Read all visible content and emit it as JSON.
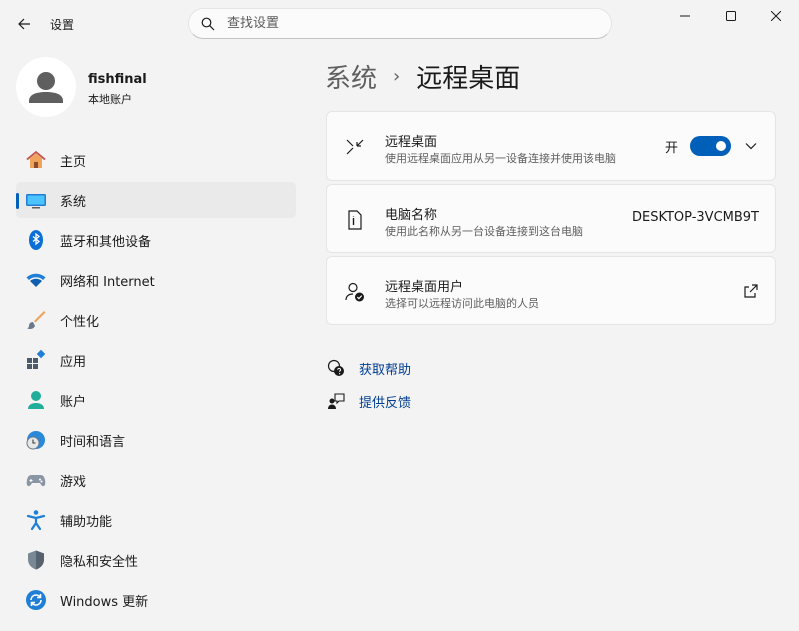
{
  "window": {
    "title": "设置",
    "controls": {
      "minimize": "minimize-icon",
      "maximize": "maximize-icon",
      "close": "close-icon"
    }
  },
  "search": {
    "placeholder": "查找设置",
    "value": ""
  },
  "profile": {
    "name": "fishfinal",
    "account_type": "本地账户"
  },
  "nav": {
    "items": [
      {
        "label": "主页",
        "icon": "home-icon",
        "active": false
      },
      {
        "label": "系统",
        "icon": "system-icon",
        "active": true
      },
      {
        "label": "蓝牙和其他设备",
        "icon": "bluetooth-icon",
        "active": false
      },
      {
        "label": "网络和 Internet",
        "icon": "wifi-icon",
        "active": false
      },
      {
        "label": "个性化",
        "icon": "brush-icon",
        "active": false
      },
      {
        "label": "应用",
        "icon": "apps-icon",
        "active": false
      },
      {
        "label": "账户",
        "icon": "account-icon",
        "active": false
      },
      {
        "label": "时间和语言",
        "icon": "time-language-icon",
        "active": false
      },
      {
        "label": "游戏",
        "icon": "gamepad-icon",
        "active": false
      },
      {
        "label": "辅助功能",
        "icon": "accessibility-icon",
        "active": false
      },
      {
        "label": "隐私和安全性",
        "icon": "shield-icon",
        "active": false
      },
      {
        "label": "Windows 更新",
        "icon": "update-icon",
        "active": false
      }
    ]
  },
  "breadcrumb": {
    "parent": "系统",
    "separator": "›",
    "current": "远程桌面"
  },
  "cards": {
    "remote_desktop": {
      "title": "远程桌面",
      "subtitle": "使用远程桌面应用从另一设备连接并使用该电脑",
      "toggle_label": "开",
      "toggle_on": true
    },
    "pc_name": {
      "title": "电脑名称",
      "subtitle": "使用此名称从另一台设备连接到这台电脑",
      "value": "DESKTOP-3VCMB9T"
    },
    "remote_users": {
      "title": "远程桌面用户",
      "subtitle": "选择可以远程访问此电脑的人员"
    }
  },
  "links": {
    "help": "获取帮助",
    "feedback": "提供反馈"
  },
  "colors": {
    "accent": "#005fb8",
    "link": "#003e92",
    "background": "#f3f3f3",
    "card": "#fbfbfb"
  }
}
